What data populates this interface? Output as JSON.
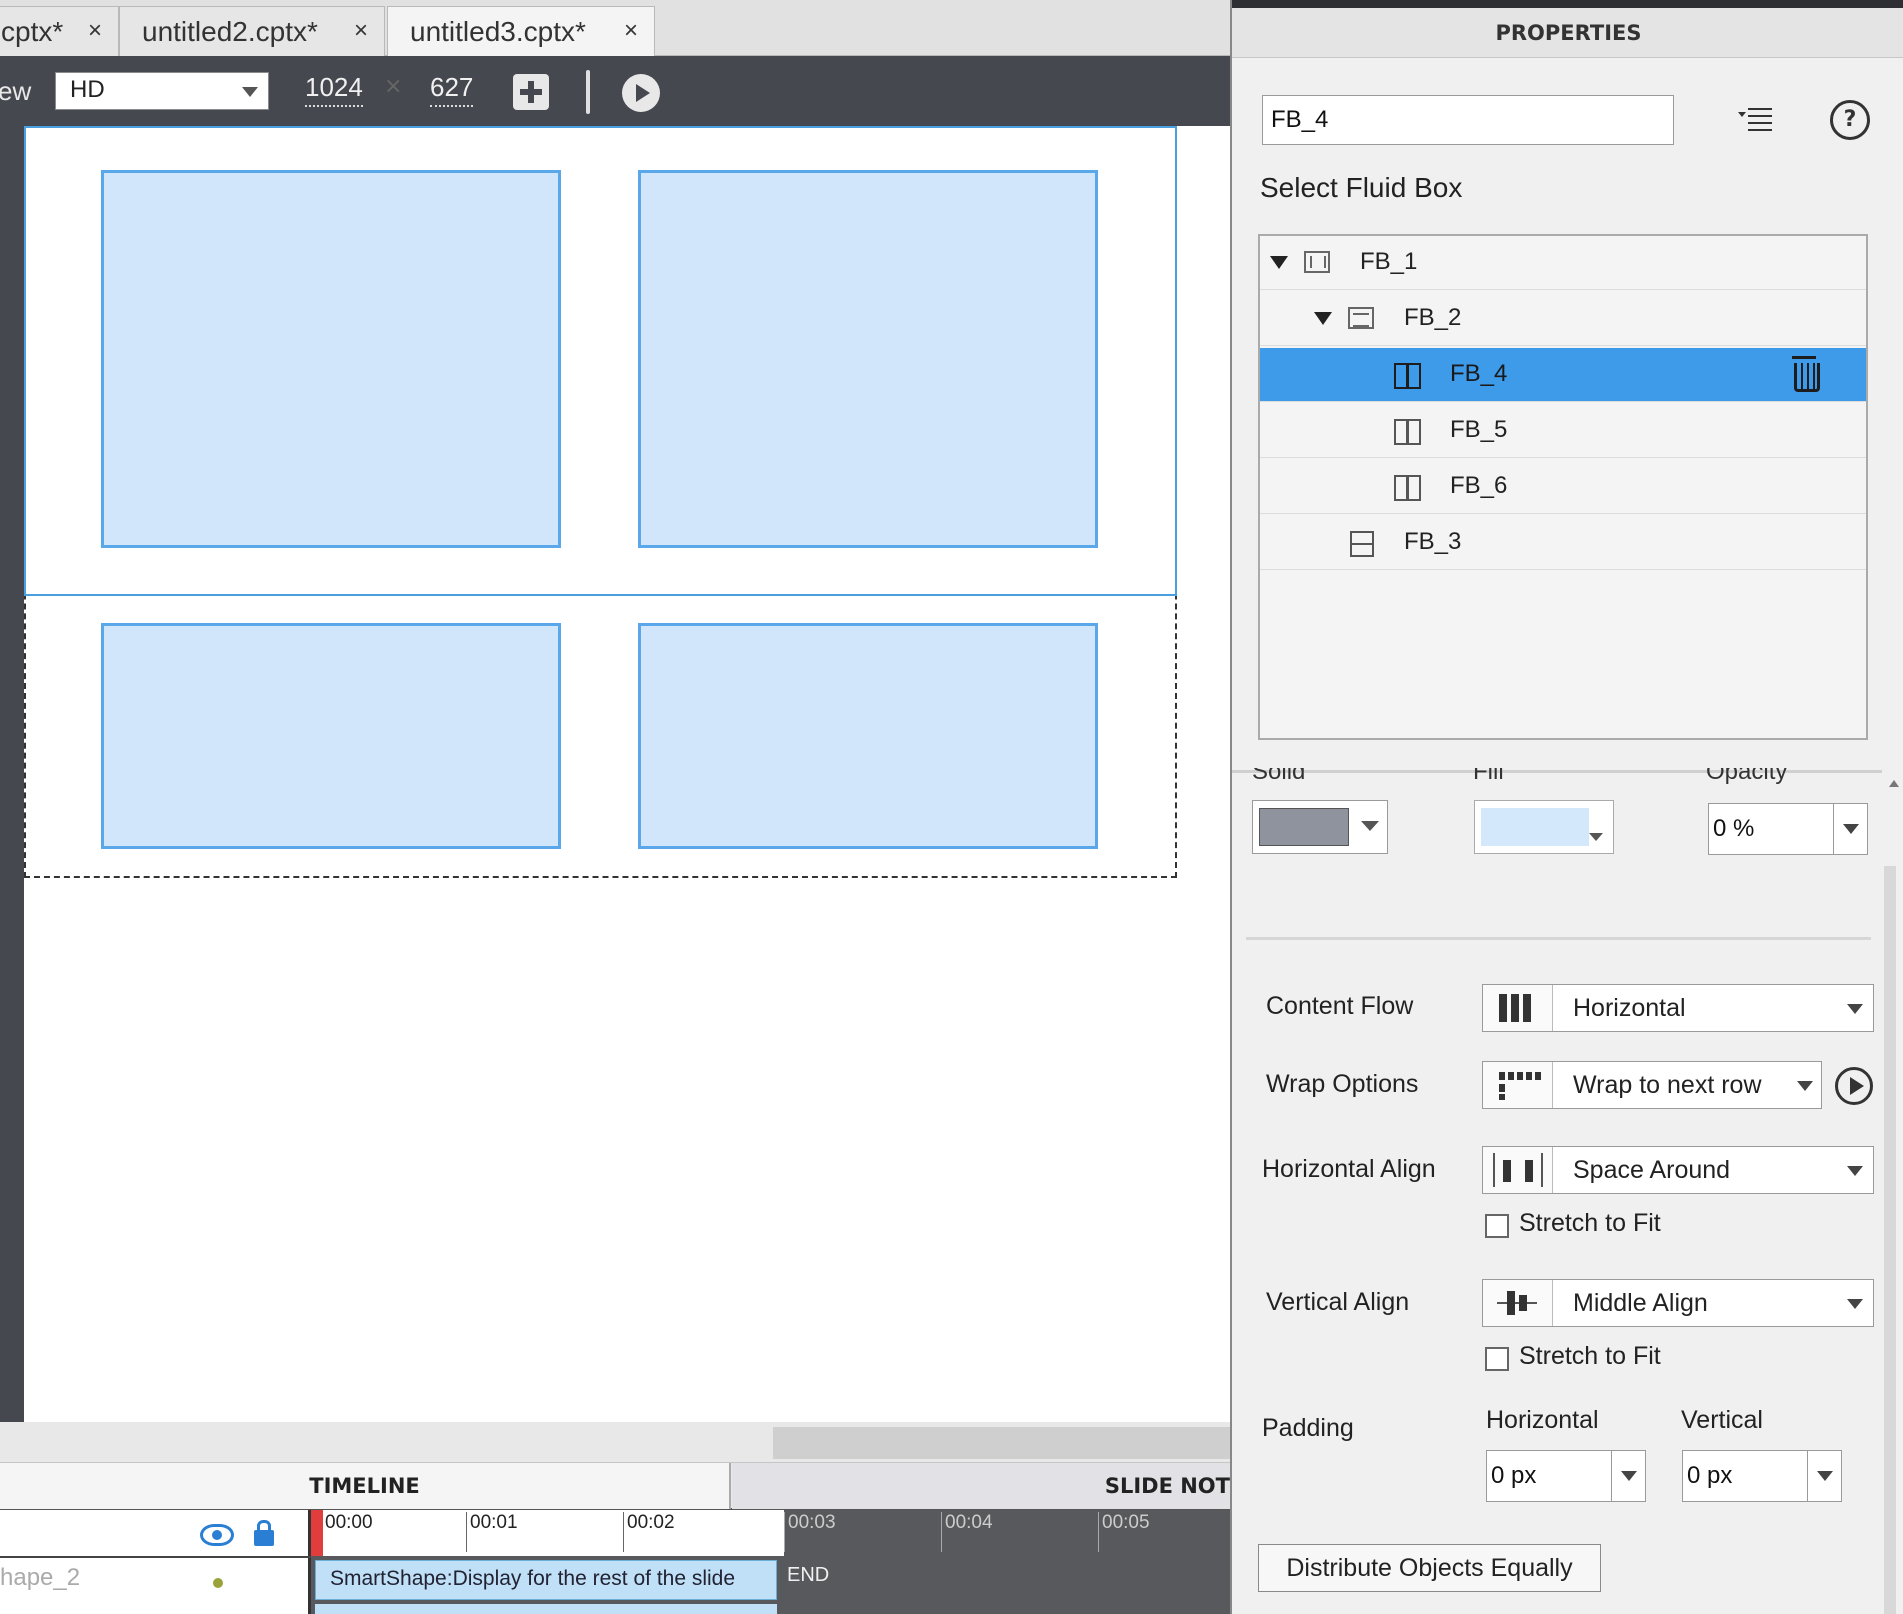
{
  "tabs": [
    {
      "label": "cptx*",
      "close": "×"
    },
    {
      "label": "untitled2.cptx*",
      "close": "×"
    },
    {
      "label": "untitled3.cptx*",
      "close": "×"
    }
  ],
  "toolbar": {
    "view_label": "ew",
    "preset": "HD",
    "width": "1024",
    "times": "×",
    "height": "627"
  },
  "timeline": {
    "tab_timeline": "TIMELINE",
    "tab_notes": "SLIDE NOT",
    "layer_name": "hape_2",
    "ticks": [
      "00:00",
      "00:01",
      "00:02",
      "00:03",
      "00:04",
      "00:05"
    ],
    "clip_label": "SmartShape:Display for the rest of the slide",
    "end_label": "END"
  },
  "properties": {
    "title": "PROPERTIES",
    "name_value": "FB_4",
    "help": "?",
    "select_title": "Select Fluid Box",
    "tree": [
      {
        "label": "FB_1",
        "level": 0,
        "expanded": true,
        "icon": "fluid-box-row-icon"
      },
      {
        "label": "FB_2",
        "level": 1,
        "expanded": true,
        "icon": "fluid-box-column-icon"
      },
      {
        "label": "FB_4",
        "level": 2,
        "selected": true,
        "icon": "split-box-icon"
      },
      {
        "label": "FB_5",
        "level": 2,
        "icon": "split-box-icon"
      },
      {
        "label": "FB_6",
        "level": 2,
        "icon": "split-box-icon"
      },
      {
        "label": "FB_3",
        "level": 1,
        "icon": "hsplit-box-icon"
      }
    ],
    "fill": {
      "solid_label": "Solid",
      "fill_label": "Fill",
      "opacity_label": "Opacity",
      "opacity_value": "0 %",
      "solid_color": "#8e939e",
      "fill_color": "#d4e8fc"
    },
    "content_flow": {
      "label": "Content Flow",
      "value": "Horizontal"
    },
    "wrap_options": {
      "label": "Wrap Options",
      "value": "Wrap to next row"
    },
    "horizontal_align": {
      "label": "Horizontal Align",
      "value": "Space Around",
      "stretch_label": "Stretch to Fit",
      "stretch_checked": false
    },
    "vertical_align": {
      "label": "Vertical Align",
      "value": "Middle Align",
      "stretch_label": "Stretch to Fit",
      "stretch_checked": false
    },
    "padding": {
      "label": "Padding",
      "h_label": "Horizontal",
      "v_label": "Vertical",
      "h_value": "0 px",
      "v_value": "0 px"
    },
    "distribute_button": "Distribute Objects Equally"
  },
  "colors": {
    "selection_blue": "#3d9be9",
    "box_fill": "#d2e6fb",
    "box_border": "#5aa7ea",
    "playhead_red": "#e23d3d"
  }
}
